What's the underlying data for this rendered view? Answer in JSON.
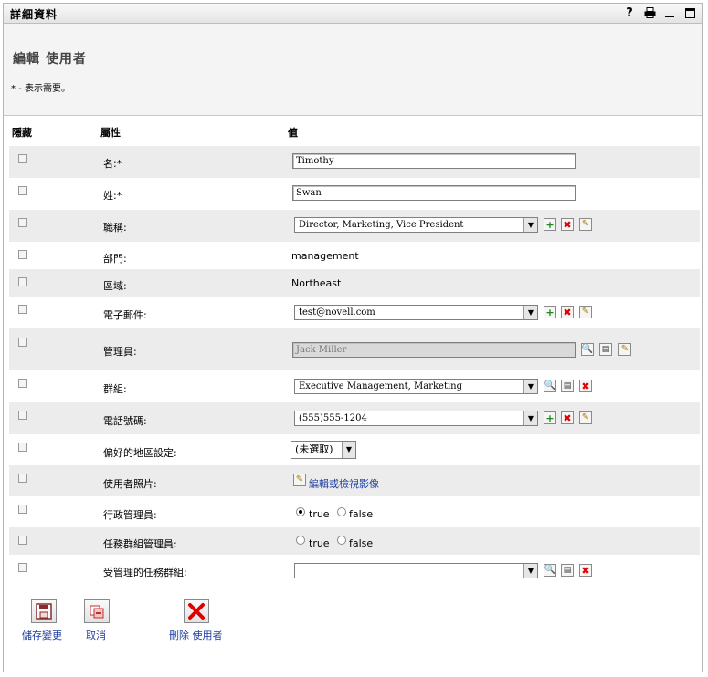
{
  "portlet": {
    "title": "詳細資料",
    "help_icon": "?"
  },
  "header": {
    "title": "編輯 使用者",
    "required_note": "* - 表示需要。"
  },
  "columns": {
    "hide": "隱藏",
    "attribute": "屬性",
    "value": "值"
  },
  "fields": {
    "first_name": {
      "label": "名:*",
      "value": "Timothy"
    },
    "last_name": {
      "label": "姓:*",
      "value": "Swan"
    },
    "title": {
      "label": "職稱:",
      "value": "Director, Marketing, Vice President"
    },
    "department": {
      "label": "部門:",
      "value": "management"
    },
    "region": {
      "label": "區域:",
      "value": "Northeast"
    },
    "email": {
      "label": "電子郵件:",
      "value": "test@novell.com"
    },
    "manager": {
      "label": "管理員:",
      "value": "Jack Miller"
    },
    "groups": {
      "label": "群組:",
      "value": "Executive Management, Marketing"
    },
    "phone": {
      "label": "電話號碼:",
      "value": "(555)555-1204"
    },
    "locale": {
      "label": "偏好的地區設定:",
      "value": "(未選取)"
    },
    "photo": {
      "label": "使用者照片:",
      "link": "編輯或檢視影像"
    },
    "admin": {
      "label": "行政管理員:",
      "true_label": "true",
      "false_label": "false",
      "selected": "true"
    },
    "task_group_admin": {
      "label": "任務群組管理員:",
      "true_label": "true",
      "false_label": "false",
      "selected": ""
    },
    "managed_task_groups": {
      "label": "受管理的任務群組:",
      "value": ""
    }
  },
  "actions": {
    "save": "儲存變更",
    "cancel": "取消",
    "delete": "刪除 使用者"
  },
  "colors": {
    "link": "#1f3f9f",
    "add": "#1a8a1a",
    "delete": "#e00000",
    "row_alt": "#ececec"
  }
}
